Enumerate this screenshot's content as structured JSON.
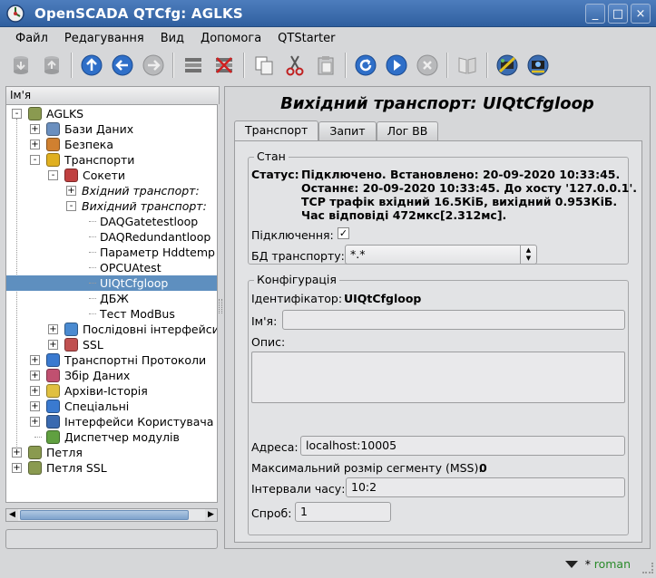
{
  "window": {
    "title": "OpenSCADA QTCfg: AGLKS",
    "buttons": {
      "minimize": "_",
      "maximize": "□",
      "close": "×"
    }
  },
  "menu": [
    {
      "label": "Файл",
      "key": "menu-file"
    },
    {
      "label": "Редагування",
      "key": "menu-edit"
    },
    {
      "label": "Вид",
      "key": "menu-view"
    },
    {
      "label": "Допомога",
      "key": "menu-help"
    },
    {
      "label": "QTStarter",
      "key": "menu-qtstarter"
    }
  ],
  "toolbar": {
    "icons": [
      "db-load-icon",
      "db-save-icon",
      "up-icon",
      "back-icon",
      "forward-icon",
      "add-item-icon",
      "delete-item-icon",
      "copy-icon",
      "cut-icon",
      "paste-icon",
      "refresh-icon",
      "start-icon",
      "stop-icon",
      "manual-icon",
      "qtcfg-icon",
      "vision-icon"
    ]
  },
  "tree": {
    "header": "Ім'я",
    "rows": [
      {
        "label": "AGLKS",
        "level": 0,
        "expander": "-",
        "icon": "station-icon",
        "italic": false
      },
      {
        "label": "Бази Даних",
        "level": 1,
        "expander": "+",
        "icon": "database-icon",
        "italic": false
      },
      {
        "label": "Безпека",
        "level": 1,
        "expander": "+",
        "icon": "security-icon",
        "italic": false
      },
      {
        "label": "Транспорти",
        "level": 1,
        "expander": "-",
        "icon": "transport-icon",
        "italic": false
      },
      {
        "label": "Сокети",
        "level": 2,
        "expander": "-",
        "icon": "sockets-icon",
        "italic": false
      },
      {
        "label": "Вхідний транспорт:",
        "level": 3,
        "expander": "+",
        "icon": "",
        "italic": true
      },
      {
        "label": "Вихідний транспорт:",
        "level": 3,
        "expander": "-",
        "icon": "",
        "italic": true
      },
      {
        "label": "DAQGatetestloop",
        "level": 4,
        "expander": "",
        "icon": "",
        "italic": false
      },
      {
        "label": "DAQRedundantloop",
        "level": 4,
        "expander": "",
        "icon": "",
        "italic": false
      },
      {
        "label": "Параметр Hddtemp",
        "level": 4,
        "expander": "",
        "icon": "",
        "italic": false
      },
      {
        "label": "OPCUAtest",
        "level": 4,
        "expander": "",
        "icon": "",
        "italic": false
      },
      {
        "label": "UIQtCfgloop",
        "level": 4,
        "expander": "",
        "icon": "",
        "italic": false,
        "selected": true
      },
      {
        "label": "ДБЖ",
        "level": 4,
        "expander": "",
        "icon": "",
        "italic": false
      },
      {
        "label": "Тест ModBus",
        "level": 4,
        "expander": "",
        "icon": "",
        "italic": false
      },
      {
        "label": "Послідовні інтерфейси",
        "level": 2,
        "expander": "+",
        "icon": "serial-icon",
        "italic": false
      },
      {
        "label": "SSL",
        "level": 2,
        "expander": "+",
        "icon": "ssl-icon",
        "italic": false
      },
      {
        "label": "Транспортні Протоколи",
        "level": 1,
        "expander": "+",
        "icon": "protocols-icon",
        "italic": false
      },
      {
        "label": "Збір Даних",
        "level": 1,
        "expander": "+",
        "icon": "daq-icon",
        "italic": false
      },
      {
        "label": "Архіви-Історія",
        "level": 1,
        "expander": "+",
        "icon": "archive-icon",
        "italic": false
      },
      {
        "label": "Спеціальні",
        "level": 1,
        "expander": "+",
        "icon": "special-icon",
        "italic": false
      },
      {
        "label": "Інтерфейси Користувача",
        "level": 1,
        "expander": "+",
        "icon": "ui-icon",
        "italic": false
      },
      {
        "label": "Диспетчер модулів",
        "level": 1,
        "expander": "",
        "icon": "modules-icon",
        "italic": false
      },
      {
        "label": "Петля",
        "level": 0,
        "expander": "+",
        "icon": "station-icon",
        "italic": false
      },
      {
        "label": "Петля SSL",
        "level": 0,
        "expander": "+",
        "icon": "station-icon",
        "italic": false
      }
    ],
    "scroll_left": "◀",
    "scroll_right": "▶"
  },
  "page": {
    "title": "Вихідний транспорт: UIQtCfgloop",
    "tabs": [
      "Транспорт",
      "Запит",
      "Лог ВВ"
    ],
    "active_tab": 0,
    "state": {
      "group_title": "Стан",
      "status_label": "Статус:",
      "status_lines": [
        "Підключено. Встановлено: 20-09-2020 10:33:45.",
        "Останнє: 20-09-2020 10:33:45. До хосту '127.0.0.1'.",
        "TCP трафік вхідний 16.5КіБ, вихідний 0.953КіБ.",
        "Час відповіді 472мкс[2.312мс]."
      ],
      "connected_label": "Підключення:",
      "connected_check": "✓",
      "db_label": "БД транспорту:",
      "db_value": "*.*"
    },
    "config": {
      "group_title": "Конфігурація",
      "id_label": "Ідентифікатор:",
      "id_value": "UIQtCfgloop",
      "name_label": "Ім'я:",
      "name_value": "",
      "descr_label": "Опис:",
      "address_label": "Адреса:",
      "address_value": "localhost:10005",
      "mss_label": "Максимальний розмір сегменту (MSS):",
      "mss_value": "0",
      "timings_label": "Інтервали часу:",
      "timings_value": "10:2",
      "attempts_label": "Спроб:",
      "attempts_value": "1"
    }
  },
  "statusbar": {
    "modified": "*",
    "user": "roman"
  }
}
